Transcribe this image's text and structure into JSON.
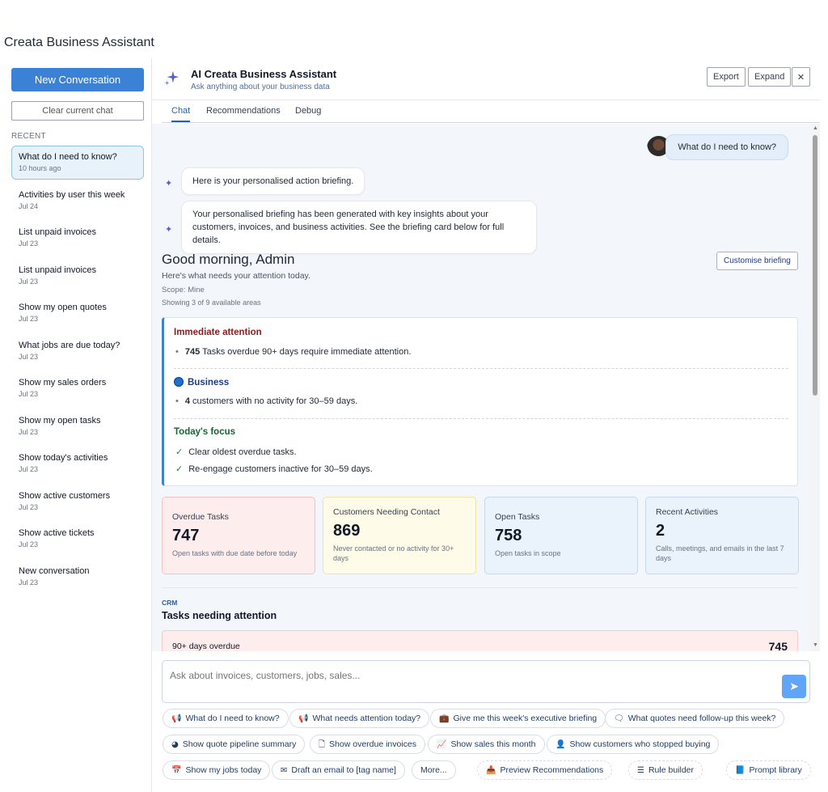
{
  "app": {
    "title": "Creata Business Assistant"
  },
  "sidebar": {
    "new_label": "New Conversation",
    "clear_label": "Clear current chat",
    "recent_label": "RECENT",
    "items": [
      {
        "title": "What do I need to know?",
        "date": "10 hours ago"
      },
      {
        "title": "Activities by user this week",
        "date": "Jul 24"
      },
      {
        "title": "List unpaid invoices",
        "date": "Jul 23"
      },
      {
        "title": "List unpaid invoices",
        "date": "Jul 23"
      },
      {
        "title": "Show my open quotes",
        "date": "Jul 23"
      },
      {
        "title": "What jobs are due today?",
        "date": "Jul 23"
      },
      {
        "title": "Show my sales orders",
        "date": "Jul 23"
      },
      {
        "title": "Show my open tasks",
        "date": "Jul 23"
      },
      {
        "title": "Show today's activities",
        "date": "Jul 23"
      },
      {
        "title": "Show active customers",
        "date": "Jul 23"
      },
      {
        "title": "Show active tickets",
        "date": "Jul 23"
      },
      {
        "title": "New conversation",
        "date": "Jul 23"
      }
    ]
  },
  "header": {
    "title": "AI Creata Business Assistant",
    "subtitle": "Ask anything about your business data",
    "export_label": "Export",
    "expand_label": "Expand",
    "close_glyph": "✕"
  },
  "tabs": [
    "Chat",
    "Recommendations",
    "Debug"
  ],
  "chat": {
    "user_message": "What do I need to know?",
    "bot_message_1": "Here is your personalised action briefing.",
    "bot_message_2_line1": "Your personalised briefing has been generated with key insights about your",
    "bot_message_2_line2": "customers, invoices, and business activities. See the briefing card below for full details."
  },
  "briefing": {
    "greeting": "Good morning, Admin",
    "subtitle": "Here's what needs your attention today.",
    "scope": "Scope: Mine",
    "showing": "Showing 3 of 9 available areas",
    "customise_label": "Customise briefing",
    "immediate_head": "Immediate attention",
    "immediate_count": "745",
    "immediate_text": " Tasks overdue 90+ days require immediate attention.",
    "business_head": "Business",
    "business_count": "4",
    "business_text": " customers with no activity for 30–59 days.",
    "focus_head": "Today's focus",
    "focus_items": [
      "Clear oldest overdue tasks.",
      "Re-engage customers inactive for 30–59 days."
    ]
  },
  "kpis": [
    {
      "label": "Overdue Tasks",
      "value": "747",
      "desc": "Open tasks with due date before today",
      "bg": "#fdeded",
      "border": "#f5c2c2"
    },
    {
      "label": "Customers Needing Contact",
      "value": "869",
      "desc": "Never contacted or no activity for 30+ days",
      "bg": "#fefbe8",
      "border": "#f3e3a3"
    },
    {
      "label": "Open Tasks",
      "value": "758",
      "desc": "Open tasks in scope",
      "bg": "#eaf2fc",
      "border": "#c6d9f0"
    },
    {
      "label": "Recent Activities",
      "value": "2",
      "desc": "Calls, meetings, and emails in the last 7 days",
      "bg": "#eaf2fc",
      "border": "#c6d9f0"
    }
  ],
  "crm": {
    "tag": "CRM",
    "title": "Tasks needing attention",
    "row_label": "90+ days overdue",
    "row_value": "745"
  },
  "composer": {
    "placeholder": "Ask about invoices, customers, jobs, sales...",
    "send_glyph": "➤"
  },
  "chips": [
    {
      "icon": "📢",
      "label": "What do I need to know?"
    },
    {
      "icon": "📢",
      "label": "What needs attention today?"
    },
    {
      "icon": "💼",
      "label": "Give me this week's executive briefing"
    },
    {
      "icon": "🗨",
      "label": "What quotes need follow-up this week?"
    },
    {
      "icon": "◕",
      "label": "Show quote pipeline summary"
    },
    {
      "icon": "🗋",
      "label": "Show overdue invoices"
    },
    {
      "icon": "📈",
      "label": "Show sales this month"
    },
    {
      "icon": "👤",
      "label": "Show customers who stopped buying"
    },
    {
      "icon": "📅",
      "label": "Show my jobs today"
    },
    {
      "icon": "✉",
      "label": "Draft an email to [tag name]"
    },
    {
      "icon": "",
      "label": "More..."
    },
    {
      "icon": "📥",
      "label": "Preview Recommendations"
    },
    {
      "icon": "☰",
      "label": "Rule builder"
    },
    {
      "icon": "📘",
      "label": "Prompt library"
    }
  ],
  "icons": {
    "assistant": "sparkle-icon",
    "send": "send-icon",
    "close": "close-icon"
  }
}
